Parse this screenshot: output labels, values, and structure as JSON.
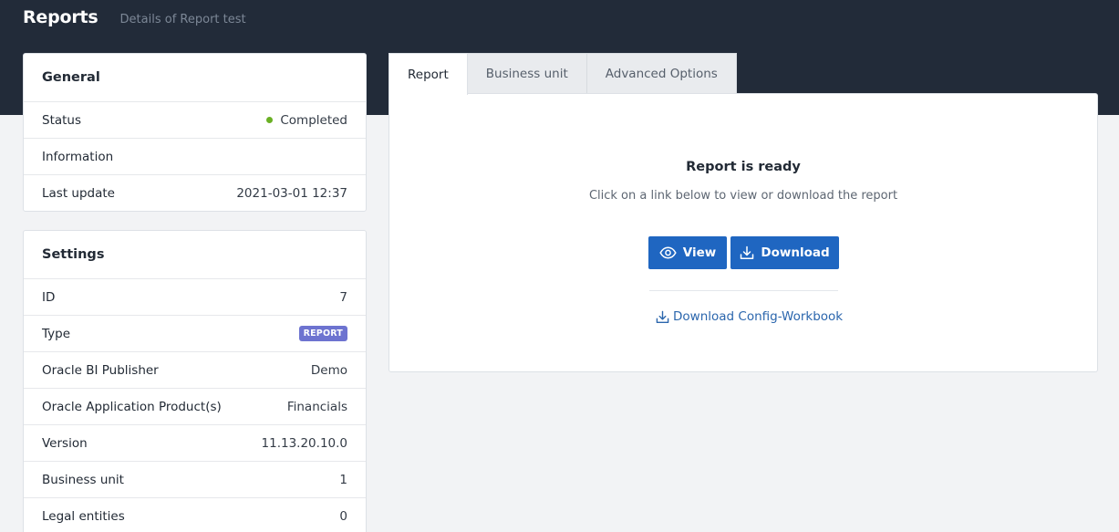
{
  "header": {
    "title": "Reports",
    "subtitle": "Details of Report test"
  },
  "general": {
    "title": "General",
    "rows": [
      {
        "label": "Status",
        "value": "Completed"
      },
      {
        "label": "Information",
        "value": ""
      },
      {
        "label": "Last update",
        "value": "2021-03-01 12:37"
      }
    ],
    "status_color": "#6ab024"
  },
  "settings": {
    "title": "Settings",
    "rows": [
      {
        "label": "ID",
        "value": "7"
      },
      {
        "label": "Type",
        "value": "REPORT"
      },
      {
        "label": "Oracle BI Publisher",
        "value": "Demo"
      },
      {
        "label": "Oracle Application Product(s)",
        "value": "Financials"
      },
      {
        "label": "Version",
        "value": "11.13.20.10.0"
      },
      {
        "label": "Business unit",
        "value": "1"
      },
      {
        "label": "Legal entities",
        "value": "0"
      }
    ],
    "badge_color": "#6d73d0"
  },
  "tabs": [
    {
      "label": "Report",
      "active": true
    },
    {
      "label": "Business unit",
      "active": false
    },
    {
      "label": "Advanced Options",
      "active": false
    }
  ],
  "report_panel": {
    "title": "Report is ready",
    "subtitle": "Click on a link below to view or download the report",
    "view_label": "View",
    "download_label": "Download",
    "config_link_label": "Download Config-Workbook",
    "view_icon": "eye-icon",
    "download_icon": "download-icon"
  },
  "colors": {
    "header_bg": "#222b39",
    "primary": "#1f66c1",
    "link": "#2b66ad"
  }
}
